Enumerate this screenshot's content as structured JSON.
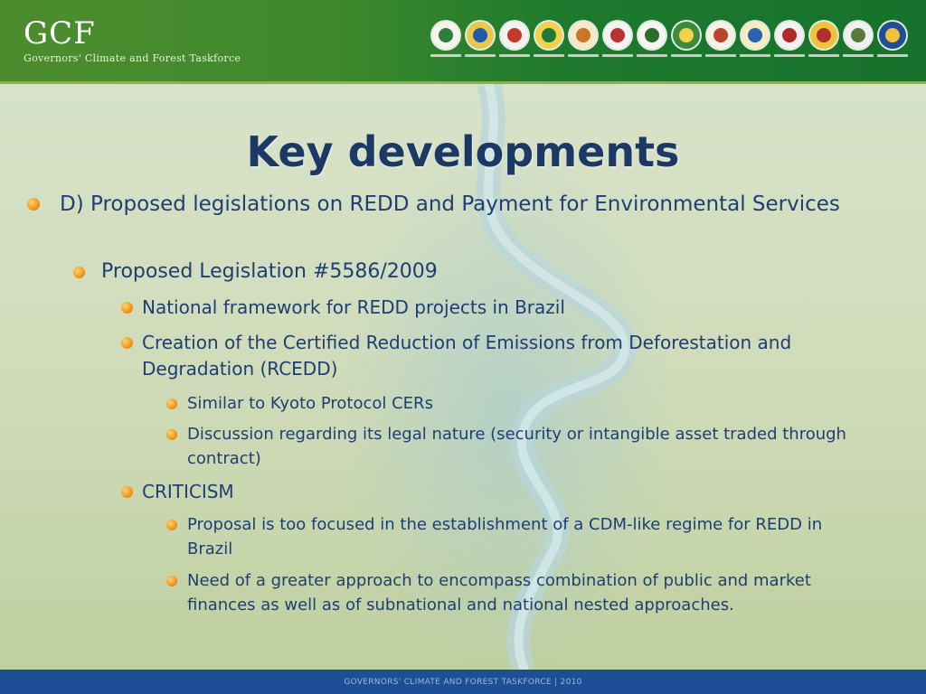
{
  "header": {
    "logo_title": "GCF",
    "logo_subtitle": "Governors' Climate and Forest Taskforce",
    "seals": [
      {
        "name": "seal-1-icon",
        "outer": "#f4f4ea",
        "inner": "#2e7d3a"
      },
      {
        "name": "seal-2-icon",
        "outer": "#e9c74a",
        "inner": "#1f5aa6"
      },
      {
        "name": "seal-3-icon",
        "outer": "#f2f2f2",
        "inner": "#c0392b"
      },
      {
        "name": "seal-4-icon",
        "outer": "#f1d24a",
        "inner": "#1f7a3a"
      },
      {
        "name": "seal-5-icon",
        "outer": "#f4e9c8",
        "inner": "#c8742a"
      },
      {
        "name": "seal-6-icon",
        "outer": "#f3f3f3",
        "inner": "#b83232"
      },
      {
        "name": "seal-7-icon",
        "outer": "#f6f6f0",
        "inner": "#2b6e2b"
      },
      {
        "name": "seal-8-icon",
        "outer": "#3d8a3d",
        "inner": "#f2d24a"
      },
      {
        "name": "seal-9-icon",
        "outer": "#f7f1e4",
        "inner": "#b7462a"
      },
      {
        "name": "seal-10-icon",
        "outer": "#f5ecc2",
        "inner": "#2a62b0"
      },
      {
        "name": "seal-11-icon",
        "outer": "#f1f1f1",
        "inner": "#b02a2a"
      },
      {
        "name": "seal-12-icon",
        "outer": "#f2c23a",
        "inner": "#b0302a"
      },
      {
        "name": "seal-13-icon",
        "outer": "#f0f0f0",
        "inner": "#5a7a3a"
      },
      {
        "name": "seal-14-icon",
        "outer": "#1f4e96",
        "inner": "#f1c23a"
      }
    ]
  },
  "title": "Key developments",
  "bullets": [
    {
      "text": "D) Proposed legislations on REDD and Payment for Environmental Services"
    },
    {
      "text": "Proposed Legislation #5586/2009"
    },
    {
      "text": "National framework for REDD projects in Brazil"
    },
    {
      "text": "Creation of the Certified Reduction of Emissions from Deforestation and Degradation (RCEDD)"
    },
    {
      "text": "Similar to Kyoto Protocol CERs"
    },
    {
      "text": "Discussion regarding its legal nature (security or intangible asset traded through contract)"
    },
    {
      "text": "CRITICISM"
    },
    {
      "text": "Proposal is too focused in the establishment of a CDM-like regime for REDD in Brazil"
    },
    {
      "text": "Need of a greater approach to encompass combination of public and market finances as well as of subnational and national nested approaches."
    }
  ],
  "footer": {
    "text": "GOVERNORS' CLIMATE AND FOREST TASKFORCE | 2010"
  },
  "colors": {
    "accent": "#f59a1a",
    "text": "#1f3e72",
    "title": "#1c3864",
    "footer": "#1e4e96"
  }
}
